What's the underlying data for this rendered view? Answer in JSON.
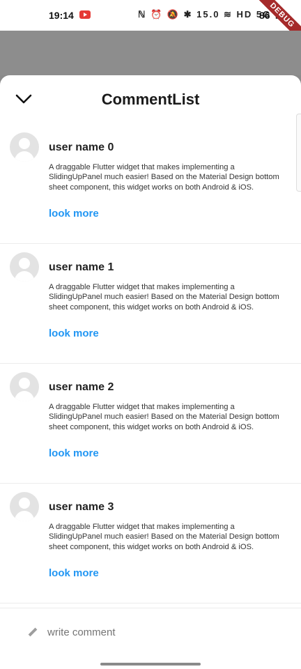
{
  "status_bar": {
    "time": "19:14",
    "icons": "ℕ ⏰ 🔕 ✱ 15.0 ≋ HD 5G ▮",
    "battery": "86",
    "debug_label": "DEBUG"
  },
  "sheet": {
    "title": "CommentList"
  },
  "comments": [
    {
      "user": "user name 0",
      "text": "A draggable Flutter widget that makes implementing a SlidingUpPanel much easier! Based on the Material Design bottom sheet component, this widget works on both Android & iOS.",
      "link": "look more"
    },
    {
      "user": "user name 1",
      "text": "A draggable Flutter widget that makes implementing a SlidingUpPanel much easier! Based on the Material Design bottom sheet component, this widget works on both Android & iOS.",
      "link": "look more"
    },
    {
      "user": "user name 2",
      "text": "A draggable Flutter widget that makes implementing a SlidingUpPanel much easier! Based on the Material Design bottom sheet component, this widget works on both Android & iOS.",
      "link": "look more"
    },
    {
      "user": "user name 3",
      "text": "A draggable Flutter widget that makes implementing a SlidingUpPanel much easier! Based on the Material Design bottom sheet component, this widget works on both Android & iOS.",
      "link": "look more"
    }
  ],
  "write_comment": {
    "placeholder": "write comment",
    "icon": "pencil-icon"
  },
  "colors": {
    "link": "#2196f3",
    "scrim": "#8d8d8d",
    "avatar_bg": "#e3e3e3"
  }
}
